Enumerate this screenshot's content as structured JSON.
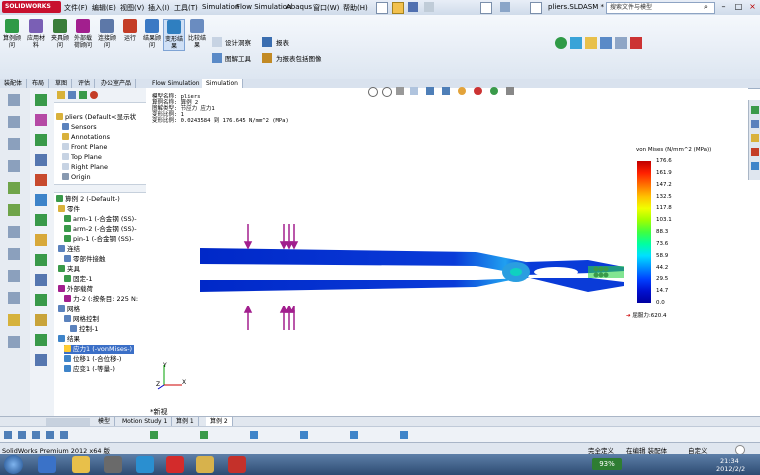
{
  "title_bar": {
    "logo": "SOLIDWORKS",
    "menus": [
      "文件(F)",
      "编辑(E)",
      "视图(V)",
      "插入(I)",
      "工具(T)",
      "Simulation",
      "Flow Simulation",
      "Abaqus",
      "窗口(W)",
      "帮助(H)"
    ],
    "document_title": "pliers.SLDASM *",
    "search_placeholder": "搜索文件与模型"
  },
  "command_manager": {
    "buttons": [
      "算例顾问",
      "应用材料",
      "夹具顾问",
      "外部载荷顾问",
      "连接顾问",
      "运行",
      "结果顾问",
      "变形结果",
      "比较结果",
      "设计洞察",
      "图解工具",
      "报表",
      "为报表包括图像"
    ],
    "tabs": [
      "装配体",
      "布局",
      "草图",
      "评估",
      "办公室产品",
      "Flow Simulation",
      "Simulation"
    ],
    "active_tab": "Simulation"
  },
  "tree": {
    "root": "pliers (Default<显示状",
    "items": [
      "Sensors",
      "Annotations",
      "Front Plane",
      "Top Plane",
      "Right Plane",
      "Origin"
    ],
    "study": "算例 2 (-Default-)",
    "parts_header": "零件",
    "parts": [
      "arm-1 (-合金钢 (SS)-",
      "arm-2 (-合金钢 (SS)-",
      "pin-1 (-合金钢 (SS)-"
    ],
    "connections_header": "连结",
    "connections": [
      "零部件接触"
    ],
    "fixtures_header": "夹具",
    "fixtures": [
      "固定-1"
    ],
    "loads_header": "外部载荷",
    "loads": [
      "力-2 (:按条目: 225 N:"
    ],
    "mesh_header": "网格",
    "mesh": [
      "网格控制",
      "控制-1"
    ],
    "results_header": "结果",
    "results": [
      "应力1 (-vonMises-)",
      "位移1 (-合位移-)",
      "应变1 (-等量-)"
    ]
  },
  "study_info": {
    "lines": [
      "模型名称: pliers",
      "算例名称: 算例 2",
      "图解类型: 节应力 应力1",
      "变形比例: 1",
      "变形比例: 0.0243584 到 176.645 N/mm^2 (MPa)"
    ]
  },
  "legend": {
    "title": "von Mises (N/mm^2 (MPa))",
    "ticks": [
      "176.6",
      "161.9",
      "147.2",
      "132.5",
      "117.8",
      "103.1",
      "88.3",
      "73.6",
      "58.9",
      "44.2",
      "29.5",
      "14.7",
      "0.0"
    ],
    "yield": "屈服力:620.4",
    "colors": [
      "#c00000",
      "#ff2000",
      "#ff7000",
      "#ffc000",
      "#f0ff00",
      "#a0ff00",
      "#40ff40",
      "#00ffa0",
      "#00e0ff",
      "#0090ff",
      "#0040ff",
      "#0010d0",
      "#0000a0"
    ]
  },
  "viewport": {
    "triad_x": "X",
    "triad_y": "Y",
    "triad_z": "Z",
    "new_view_label": "新视"
  },
  "model_tabs": [
    "模型",
    "Motion Study 1",
    "算例 1",
    "算例 2"
  ],
  "status_bar": {
    "product": "SolidWorks Premium 2012 x64 版",
    "items": [
      "完全定义",
      "在编辑 装配体",
      "自定义"
    ]
  },
  "taskbar": {
    "battery": "93%",
    "time": "21:34",
    "date": "2012/2/2"
  }
}
